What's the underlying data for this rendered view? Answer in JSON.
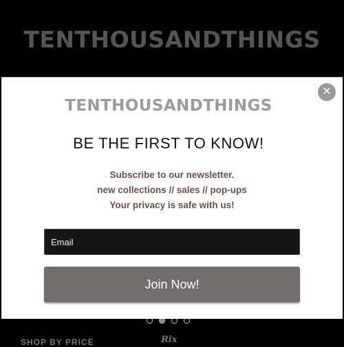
{
  "site": {
    "brand": "TENTHOUSANDTHINGS"
  },
  "modal": {
    "brand": "TENTHOUSANDTHINGS",
    "headline": "BE THE FIRST TO KNOW!",
    "lines": [
      "Subscribe to our newsletter.",
      "new collections // sales // pop-ups",
      "Your privacy is safe with us!"
    ],
    "email_placeholder": "Email",
    "submit_label": "Join Now!",
    "close_glyph": "✕",
    "colors": {
      "button": "#726d6d",
      "email_bg": "#151515",
      "text_brown": "#6b4f4f"
    }
  },
  "carousel": {
    "dots": 4,
    "active_index": 1
  },
  "footer_peek": {
    "left_text": "SHOP BY PRICE",
    "mid_text": "Rix"
  }
}
